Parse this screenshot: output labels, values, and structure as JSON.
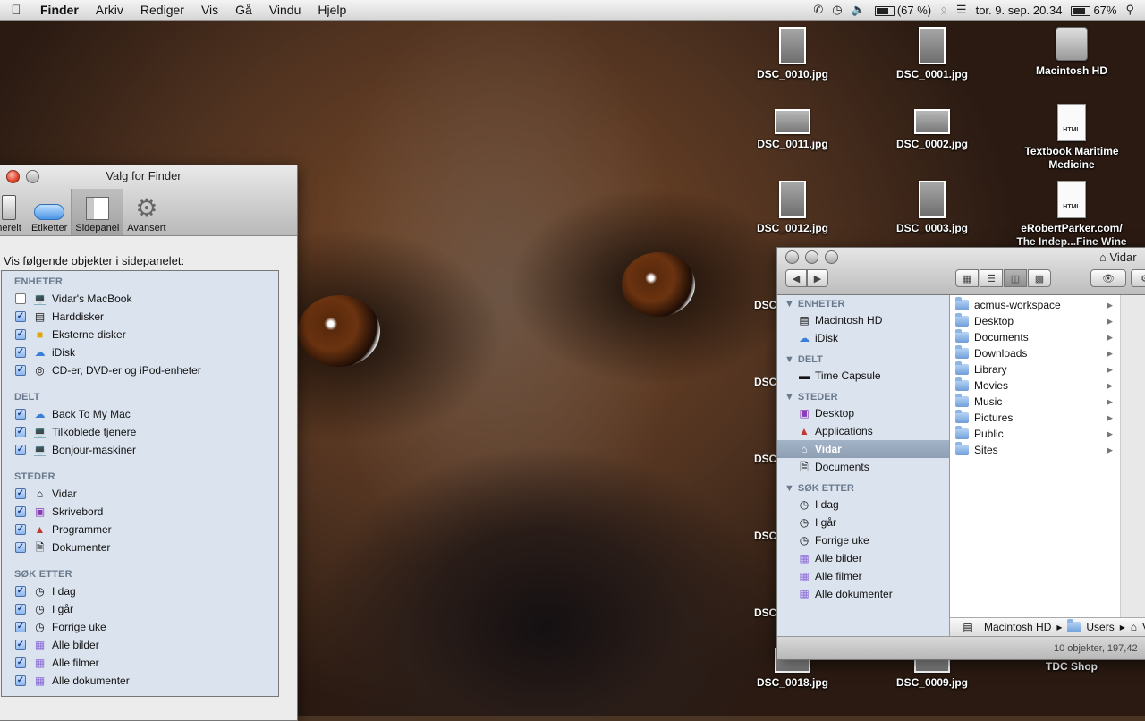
{
  "menubar": {
    "app": "Finder",
    "menus": [
      "Arkiv",
      "Rediger",
      "Vis",
      "Gå",
      "Vindu",
      "Hjelp"
    ],
    "battery_text": "(67 %)",
    "datetime": "tor. 9. sep. 20.34",
    "battery2": "67%"
  },
  "desktop_icons": [
    {
      "label": "DSC_0010.jpg"
    },
    {
      "label": "DSC_0001.jpg"
    },
    {
      "label": "Macintosh HD"
    },
    {
      "label": "DSC_0011.jpg"
    },
    {
      "label": "DSC_0002.jpg"
    },
    {
      "label": "Textbook Maritime Medicine"
    },
    {
      "label": "DSC_0012.jpg"
    },
    {
      "label": "DSC_0003.jpg"
    },
    {
      "label": "eRobertParker.com/ The Indep...Fine Wine"
    },
    {
      "label": "DSC_0018.jpg"
    },
    {
      "label": "DSC_0009.jpg"
    },
    {
      "label": "TDC Shop"
    }
  ],
  "html_badge": "HTML",
  "partial_labels": [
    "DSC",
    "DSC",
    "DSC",
    "DSC",
    "DSC"
  ],
  "prefs": {
    "title": "Valg for Finder",
    "tabs": [
      "nerelt",
      "Etiketter",
      "Sidepanel",
      "Avansert"
    ],
    "heading": "Vis følgende objekter i sidepanelet:",
    "groups": [
      {
        "title": "ENHETER",
        "items": [
          {
            "label": "Vidar's MacBook",
            "checked": false
          },
          {
            "label": "Harddisker",
            "checked": true
          },
          {
            "label": "Eksterne disker",
            "checked": true
          },
          {
            "label": "iDisk",
            "checked": true
          },
          {
            "label": "CD-er, DVD-er og iPod-enheter",
            "checked": true
          }
        ]
      },
      {
        "title": "DELT",
        "items": [
          {
            "label": "Back To My Mac",
            "checked": true
          },
          {
            "label": "Tilkoblede tjenere",
            "checked": true
          },
          {
            "label": "Bonjour-maskiner",
            "checked": true
          }
        ]
      },
      {
        "title": "STEDER",
        "items": [
          {
            "label": "Vidar",
            "checked": true
          },
          {
            "label": "Skrivebord",
            "checked": true
          },
          {
            "label": "Programmer",
            "checked": true
          },
          {
            "label": "Dokumenter",
            "checked": true
          }
        ]
      },
      {
        "title": "SØK ETTER",
        "items": [
          {
            "label": "I dag",
            "checked": true
          },
          {
            "label": "I går",
            "checked": true
          },
          {
            "label": "Forrige uke",
            "checked": true
          },
          {
            "label": "Alle bilder",
            "checked": true
          },
          {
            "label": "Alle filmer",
            "checked": true
          },
          {
            "label": "Alle dokumenter",
            "checked": true
          }
        ]
      }
    ]
  },
  "finder": {
    "title": "Vidar",
    "sidebar": [
      {
        "title": "ENHETER",
        "items": [
          "Macintosh HD",
          "iDisk"
        ]
      },
      {
        "title": "DELT",
        "items": [
          "Time Capsule"
        ]
      },
      {
        "title": "STEDER",
        "items": [
          "Desktop",
          "Applications",
          "Vidar",
          "Documents"
        ]
      },
      {
        "title": "SØK ETTER",
        "items": [
          "I dag",
          "I går",
          "Forrige uke",
          "Alle bilder",
          "Alle filmer",
          "Alle dokumenter"
        ]
      }
    ],
    "selected_sidebar_item": "Vidar",
    "folders": [
      "acmus-workspace",
      "Desktop",
      "Documents",
      "Downloads",
      "Library",
      "Movies",
      "Music",
      "Pictures",
      "Public",
      "Sites"
    ],
    "path": [
      "Macintosh HD",
      "Users",
      "Vi"
    ],
    "status": "10 objekter, 197,42"
  }
}
